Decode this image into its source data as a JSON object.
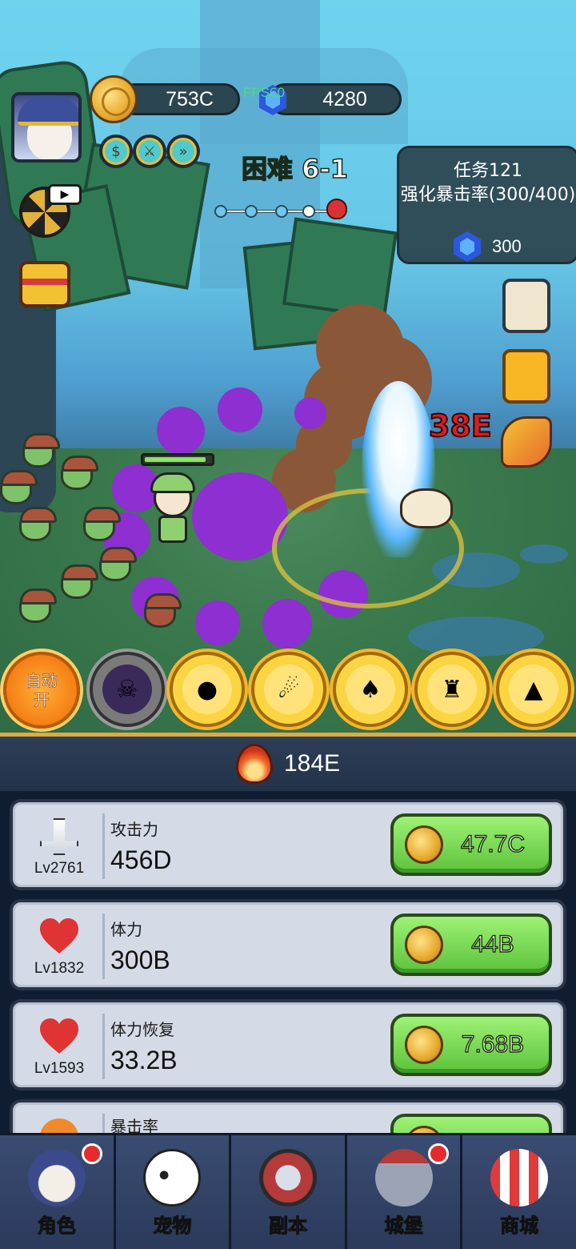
{
  "hud": {
    "coins": "753C",
    "gems": "4280",
    "fps": "FPS60",
    "stage_difficulty": "困难",
    "stage_level": "6-1",
    "stage_progress": "3 of 4"
  },
  "quest": {
    "title": "任务121",
    "description": "强化暴击率(300/400)",
    "reward": "300"
  },
  "battle": {
    "damage_text": "38E",
    "hero_hp_fraction": 0.88
  },
  "skills": {
    "auto_label_1": "自动",
    "auto_label_2": "开"
  },
  "panel": {
    "power": "184E",
    "upgrades": [
      {
        "name": "攻击力",
        "value": "456D",
        "level": "Lv2761",
        "cost": "47.7C",
        "icon": "sword-icon"
      },
      {
        "name": "体力",
        "value": "300B",
        "level": "Lv1832",
        "cost": "44B",
        "icon": "heart-icon"
      },
      {
        "name": "体力恢复",
        "value": "33.2B",
        "level": "Lv1593",
        "cost": "7.68B",
        "icon": "heart-plus-icon"
      },
      {
        "name": "暴击率",
        "value": "",
        "level": "",
        "cost": "",
        "icon": "claw-icon"
      }
    ]
  },
  "nav": {
    "tabs": [
      {
        "label": "角色",
        "badge": true
      },
      {
        "label": "宠物",
        "badge": false
      },
      {
        "label": "副本",
        "badge": false
      },
      {
        "label": "城堡",
        "badge": true
      },
      {
        "label": "商城",
        "badge": false
      }
    ]
  },
  "colors": {
    "gold_accent": "#e2a93c",
    "buy_green": "#6ccf45",
    "panel_bg": "#101c2f"
  }
}
